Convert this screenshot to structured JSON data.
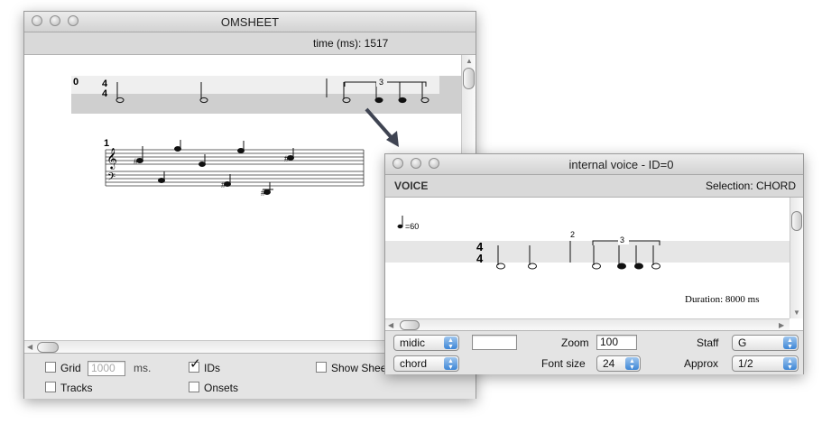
{
  "omsheet": {
    "title": "OMSHEET",
    "time_label": "time (ms): 1517",
    "track0_id": "0",
    "track1_id": "1",
    "tuplet": "3",
    "controls": {
      "grid_label": "Grid",
      "grid_value": "1000",
      "grid_unit": "ms.",
      "ids_label": "IDs",
      "ids_checked": true,
      "show_sheet_label": "Show Shee",
      "tracks_label": "Tracks",
      "onsets_label": "Onsets"
    }
  },
  "voice": {
    "title": "internal voice - ID=0",
    "header_label": "VOICE",
    "selection": "Selection: CHORD",
    "tempo": "=60",
    "measure_number": "2",
    "tuplet": "3",
    "duration": "Duration: 8000 ms",
    "controls": {
      "pitch_mode": "midic",
      "edit_mode": "chord",
      "text_field": "",
      "zoom_label": "Zoom",
      "zoom_value": "100",
      "fontsize_label": "Font size",
      "fontsize_value": "24",
      "staff_label": "Staff",
      "staff_value": "G",
      "approx_label": "Approx",
      "approx_value": "1/2"
    }
  },
  "icons": [
    "close-icon",
    "minimize-icon",
    "zoom-icon",
    "checkbox-icon",
    "checkmark-icon",
    "arrow-icon",
    "treble-clef-icon",
    "bass-clef-icon",
    "quarter-note-icon",
    "resize-grip-icon",
    "dropdown-arrows-icon"
  ]
}
